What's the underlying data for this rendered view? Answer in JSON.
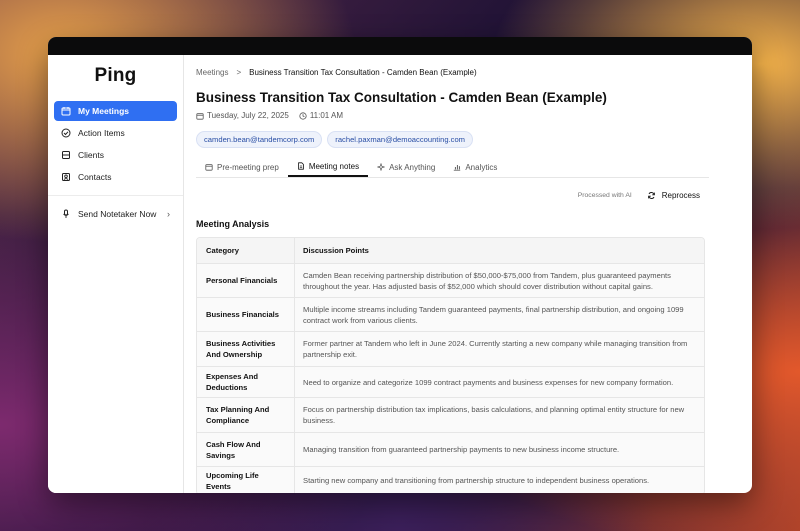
{
  "app": {
    "logo": "Ping"
  },
  "sidebar": {
    "items": [
      {
        "label": "My Meetings",
        "active": true,
        "icon": "calendar-icon"
      },
      {
        "label": "Action Items",
        "active": false,
        "icon": "check-circle-icon"
      },
      {
        "label": "Clients",
        "active": false,
        "icon": "users-icon"
      },
      {
        "label": "Contacts",
        "active": false,
        "icon": "contact-icon"
      }
    ],
    "notetaker": {
      "label": "Send Notetaker Now",
      "icon": "microphone-icon"
    }
  },
  "breadcrumb": {
    "root": "Meetings",
    "separator": ">",
    "current": "Business Transition Tax Consultation - Camden Bean (Example)"
  },
  "meeting": {
    "title": "Business Transition Tax Consultation - Camden Bean (Example)",
    "date": "Tuesday, July 22, 2025",
    "time": "11:01 AM",
    "attendees": [
      "camden.bean@tandemcorp.com",
      "rachel.paxman@demoaccounting.com"
    ]
  },
  "tabs": [
    {
      "label": "Pre-meeting prep",
      "icon": "calendar-icon",
      "active": false
    },
    {
      "label": "Meeting notes",
      "icon": "document-icon",
      "active": true
    },
    {
      "label": "Ask Anything",
      "icon": "sparkle-icon",
      "active": false
    },
    {
      "label": "Analytics",
      "icon": "chart-icon",
      "active": false
    }
  ],
  "actions": {
    "ai_note": "Processed with AI",
    "reprocess_label": "Reprocess"
  },
  "analysis": {
    "title": "Meeting Analysis",
    "headers": [
      "Category",
      "Discussion Points"
    ],
    "rows": [
      {
        "category": "Personal Financials",
        "points": "Camden Bean receiving partnership distribution of $50,000-$75,000 from Tandem, plus guaranteed payments throughout the year. Has adjusted basis of $52,000 which should cover distribution without capital gains."
      },
      {
        "category": "Business Financials",
        "points": "Multiple income streams including Tandem guaranteed payments, final partnership distribution, and ongoing 1099 contract work from various clients."
      },
      {
        "category": "Business Activities And Ownership",
        "points": "Former partner at Tandem who left in June 2024. Currently starting a new company while managing transition from partnership exit."
      },
      {
        "category": "Expenses And Deductions",
        "points": "Need to organize and categorize 1099 contract payments and business expenses for new company formation."
      },
      {
        "category": "Tax Planning And Compliance",
        "points": "Focus on partnership distribution tax implications, basis calculations, and planning optimal entity structure for new business."
      },
      {
        "category": "Cash Flow And Savings",
        "points": "Managing transition from guaranteed partnership payments to new business income structure."
      },
      {
        "category": "Upcoming Life Events",
        "points": "Starting new company and transitioning from partnership structure to independent business operations."
      }
    ]
  }
}
